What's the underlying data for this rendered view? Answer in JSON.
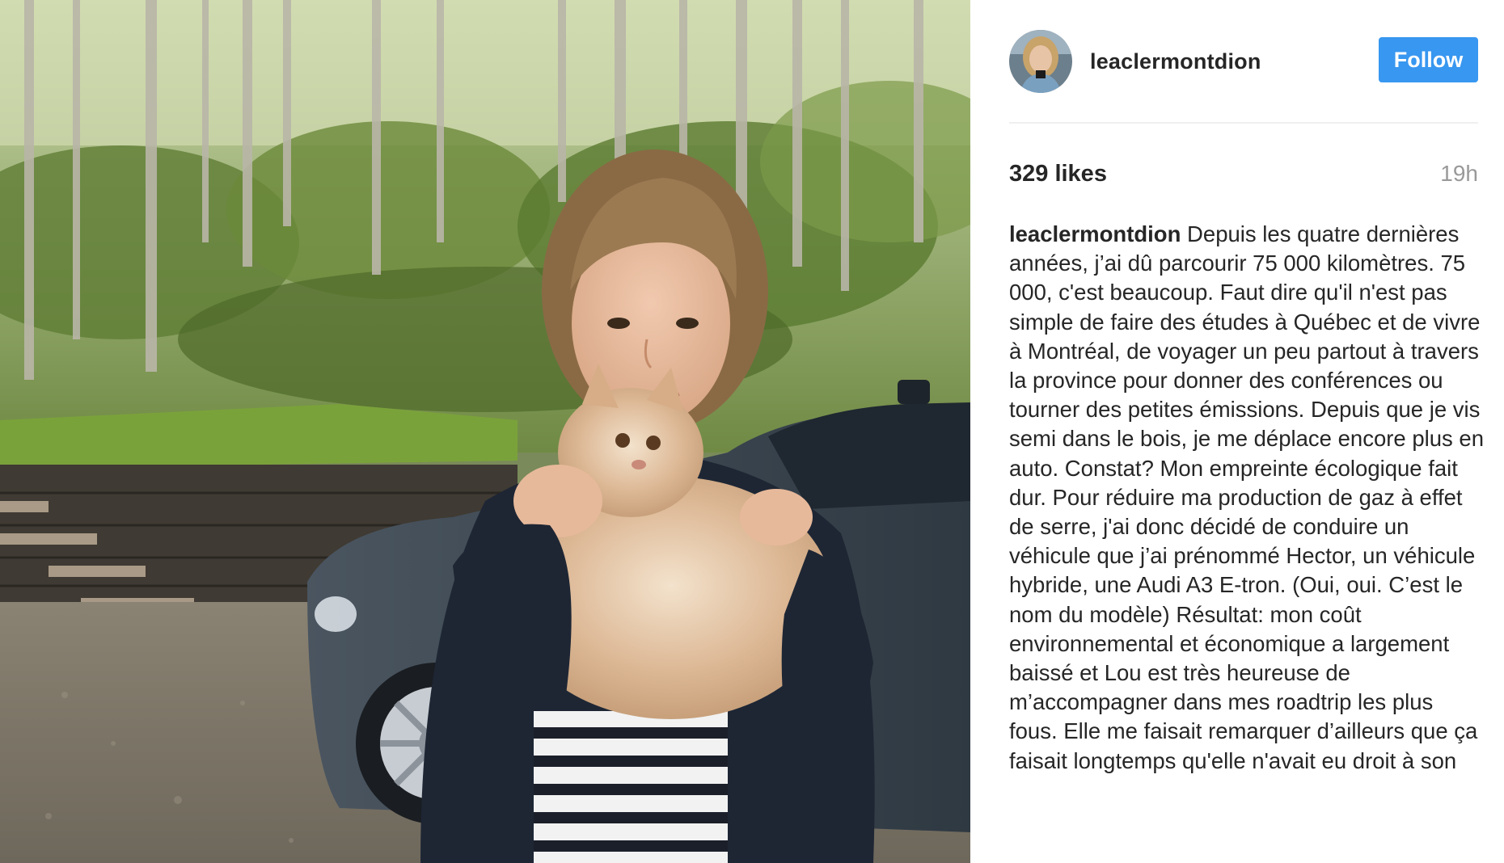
{
  "post": {
    "username": "leaclermontdion",
    "follow_label": "Follow",
    "likes": "329 likes",
    "time": "19h",
    "caption_user": "leaclermontdion",
    "caption_text": "Depuis les quatre dernières années, j’ai dû parcourir 75 000 kilomètres. 75 000, c'est beaucoup. Faut dire qu'il n'est pas simple de faire des études à Québec et de vivre à Montréal, de voyager un peu partout à travers la province pour donner des conférences ou tourner des petites émissions. Depuis que je vis semi dans le bois, je me déplace encore plus en auto. Constat? Mon empreinte écologique fait dur. Pour réduire ma production de gaz à effet de serre, j'ai donc décidé de conduire un véhicule que j’ai prénommé Hector, un véhicule hybride, une Audi A3 E-tron. (Oui, oui. C’est le nom du modèle) Résultat: mon coût environnemental et économique a largement baissé et Lou est très heureuse de m’accompagner dans mes roadtrip les plus fous. Elle me faisait remarquer d’ailleurs que ça faisait longtemps qu'elle n'avait eu droit à son"
  },
  "colors": {
    "follow_button": "#3897f0",
    "text": "#262626",
    "muted": "#999999",
    "divider": "#efefef"
  },
  "icons": {
    "avatar": "profile-photo"
  }
}
